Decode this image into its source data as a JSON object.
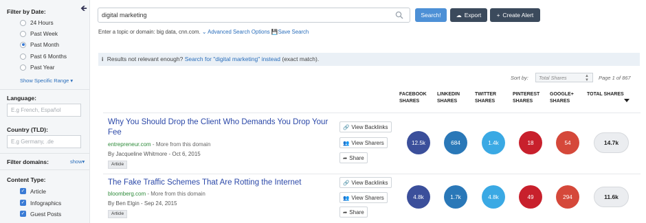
{
  "sidebar": {
    "filter_date_heading": "Filter by Date:",
    "date_options": [
      {
        "label": "24 Hours",
        "checked": false
      },
      {
        "label": "Past Week",
        "checked": false
      },
      {
        "label": "Past Month",
        "checked": true
      },
      {
        "label": "Past 6 Months",
        "checked": false
      },
      {
        "label": "Past Year",
        "checked": false
      }
    ],
    "specific_range": "Show Specific Range",
    "language_heading": "Language:",
    "language_placeholder": "E.g French, Español",
    "country_heading": "Country (TLD):",
    "country_placeholder": "E.g Germany, .de",
    "filter_domains_heading": "Filter domains:",
    "filter_domains_show": "show",
    "content_type_heading": "Content Type:",
    "content_types": [
      {
        "label": "Article",
        "checked": true
      },
      {
        "label": "Infographics",
        "checked": true
      },
      {
        "label": "Guest Posts",
        "checked": true
      }
    ]
  },
  "search": {
    "value": "digital marketing",
    "search_button": "Search!",
    "export_button": "Export",
    "alert_button": "Create Alert",
    "hint_text": "Enter a topic or domain: big data, cnn.com.",
    "advanced_link": "Advanced Search Options",
    "save_link": "Save Search"
  },
  "notice": {
    "prefix": "Results not relevant enough?",
    "link": "Search for \"digital marketing\" instead",
    "suffix": "(exact match)."
  },
  "sort": {
    "label": "Sort by:",
    "value": "Total Shares",
    "page_info": "Page 1 of 867"
  },
  "columns": [
    {
      "line1": "FACEBOOK",
      "line2": "SHARES"
    },
    {
      "line1": "LINKEDIN",
      "line2": "SHARES"
    },
    {
      "line1": "TWITTER",
      "line2": "SHARES"
    },
    {
      "line1": "PINTEREST",
      "line2": "SHARES"
    },
    {
      "line1": "GOOGLE+",
      "line2": "SHARES"
    },
    {
      "line1": "TOTAL SHARES",
      "line2": ""
    }
  ],
  "actions": {
    "backlinks": "View Backlinks",
    "sharers": "View Sharers",
    "share": "Share"
  },
  "colors": {
    "facebook": "#3b4f9b",
    "linkedin": "#2a78b8",
    "twitter": "#3aa9e4",
    "pinterest": "#c8202c",
    "google": "#d5483a"
  },
  "articles": [
    {
      "title": "Why You Should Drop the Client Who Demands You Drop Your Fee",
      "domain": "entrepreneur.com",
      "more": " - More from this domain",
      "author_line": "By Jacqueline Whitmore - Oct 6, 2015",
      "tag": "Article",
      "facebook": "12.5k",
      "linkedin": "684",
      "twitter": "1.4k",
      "pinterest": "18",
      "google": "54",
      "total": "14.7k"
    },
    {
      "title": "The Fake Traffic Schemes That Are Rotting the Internet",
      "domain": "bloomberg.com",
      "more": " - More from this domain",
      "author_line": "By Ben Elgin - Sep 24, 2015",
      "tag": "Article",
      "facebook": "4.8k",
      "linkedin": "1.7k",
      "twitter": "4.8k",
      "pinterest": "49",
      "google": "294",
      "total": "11.6k"
    }
  ]
}
